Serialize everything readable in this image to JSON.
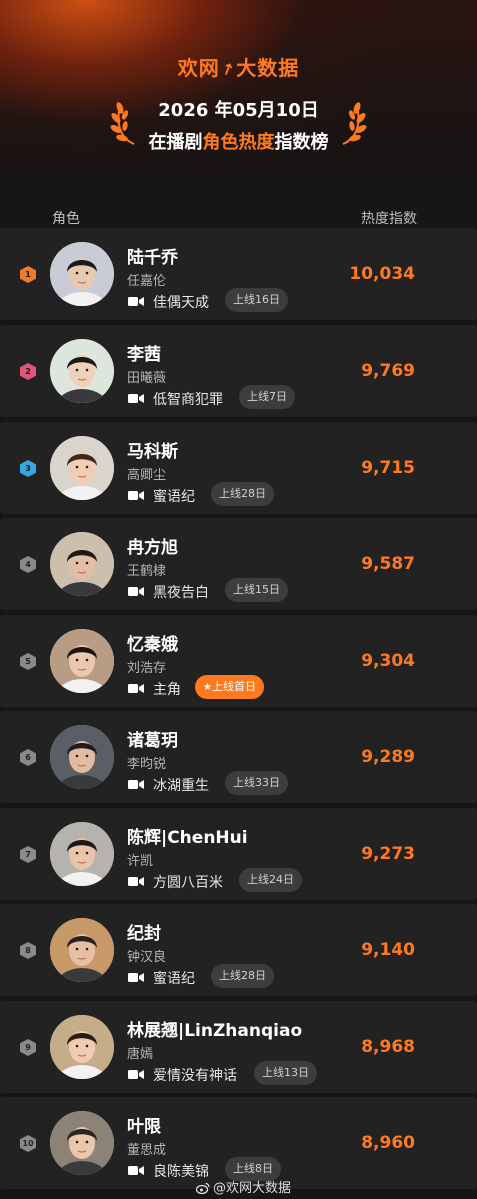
{
  "header": {
    "brand_part1": "欢网",
    "brand_part2": "大数据",
    "date": "2026 年05月10日",
    "title_pre": "在播剧",
    "title_highlight": "角色热度",
    "title_post": "指数榜",
    "accent_color": "#ff7a1f"
  },
  "columns": {
    "role": "角色",
    "heat": "热度指数"
  },
  "rows": [
    {
      "rank": "1",
      "name": "陆千乔",
      "actor": "任嘉伦",
      "drama": "佳偶天成",
      "badge": "上线16日",
      "score": "10,034",
      "rank_color": "#f07a2a"
    },
    {
      "rank": "2",
      "name": "李茜",
      "actor": "田曦薇",
      "drama": "低智商犯罪",
      "badge": "上线7日",
      "score": "9,769",
      "rank_color": "#e0577a"
    },
    {
      "rank": "3",
      "name": "马科斯",
      "actor": "高卿尘",
      "drama": "蜜语纪",
      "badge": "上线28日",
      "score": "9,715",
      "rank_color": "#3aa6e0"
    },
    {
      "rank": "4",
      "name": "冉方旭",
      "actor": "王鹤棣",
      "drama": "黑夜告白",
      "badge": "上线15日",
      "score": "9,587",
      "rank_color": "#8a8a8a"
    },
    {
      "rank": "5",
      "name": "忆秦娥",
      "actor": "刘浩存",
      "drama": "主角",
      "badge": "上线首日",
      "badge_star": "★",
      "score": "9,304",
      "rank_color": "#8a8a8a"
    },
    {
      "rank": "6",
      "name": "诸葛玥",
      "actor": "李昀锐",
      "drama": "冰湖重生",
      "badge": "上线33日",
      "score": "9,289",
      "rank_color": "#8a8a8a"
    },
    {
      "rank": "7",
      "name": "陈辉|ChenHui",
      "actor": "许凯",
      "drama": "方圆八百米",
      "badge": "上线24日",
      "score": "9,273",
      "rank_color": "#8a8a8a"
    },
    {
      "rank": "8",
      "name": "纪封",
      "actor": "钟汉良",
      "drama": "蜜语纪",
      "badge": "上线28日",
      "score": "9,140",
      "rank_color": "#8a8a8a"
    },
    {
      "rank": "9",
      "name": "林展翘|LinZhanqiao",
      "actor": "唐嫣",
      "drama": "爱情没有神话",
      "badge": "上线13日",
      "score": "8,968",
      "rank_color": "#8a8a8a"
    },
    {
      "rank": "10",
      "name": "叶限",
      "actor": "董思成",
      "drama": "良陈美锦",
      "badge": "上线8日",
      "score": "8,960",
      "rank_color": "#8a8a8a"
    }
  ],
  "watermark": "@欢网大数据"
}
